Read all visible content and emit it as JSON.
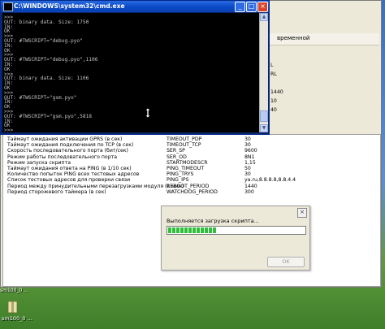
{
  "console": {
    "title": "C:\\WINDOWS\\system32\\cmd.exe",
    "lines": [
      ">>>",
      "OUT: binary data. Size: 1750",
      "IN:",
      "OK",
      ">>>",
      "OUT: #TWSCRIPT=\"debug.pyo\"",
      "IN:",
      "OK",
      ">>>",
      "OUT: #TWSCRIPT=\"debug.pyo\",1106",
      "IN:",
      "OK",
      ">>>",
      "OUT: binary data. Size: 1106",
      "IN:",
      "OK",
      ">>>",
      "OUT: #TWSCRIPT=\"gsm.pyo\"",
      "IN:",
      "OK",
      ">>>",
      "OUT: #TWSCRIPT=\"gsm.pyo\",5818",
      "IN:",
      "OK",
      ">>>"
    ]
  },
  "background_window": {
    "column_header": "временной",
    "side_values": [
      "L",
      "RL",
      "",
      "1440",
      "10",
      "40",
      "",
      "",
      ""
    ],
    "rows": [
      {
        "desc": "Таймаут ожидания активации GPRS (в сек)",
        "param": "TIMEOUT_PDP",
        "value": "30"
      },
      {
        "desc": "Таймаут ожидания подключения по TCP (в сек)",
        "param": "TIMEOUT_TCP",
        "value": "30"
      },
      {
        "desc": "Скорость последовательного порта (бит/сек)",
        "param": "SER_SP",
        "value": "9600"
      },
      {
        "desc": "Режим работы последовательного порта",
        "param": "SER_OD",
        "value": "8N1"
      },
      {
        "desc": "Режим запуска скрипта",
        "param": "STARTMODESCR",
        "value": "1,15"
      },
      {
        "desc": "Таймаут ожидания ответа на PING (в 1/10 сек)",
        "param": "PING_TIMEOUT",
        "value": "50"
      },
      {
        "desc": "Количество попыток PING всех тестовых адресов",
        "param": "PING_TRYS",
        "value": "30"
      },
      {
        "desc": "Список тестовых адресов для проверки связи",
        "param": "PING_IPS",
        "value": "ya.ru,8.8.8.8,8.8.4.4"
      },
      {
        "desc": "Период между принудительными перезагрузками модуля (в мин)",
        "param": "REBOOT_PERIOD",
        "value": "1440"
      },
      {
        "desc": "Период сторожевого таймера (в сек)",
        "param": "WATCHDOG_PERIOD",
        "value": "300"
      }
    ]
  },
  "dialog": {
    "message": "Выполняется загрузка скрипта...",
    "progress_segments": 12,
    "ok_label": "OK"
  },
  "desktop": {
    "caption": "sm100_0 ...",
    "icon_label": "sm100_0 ..."
  },
  "colors": {
    "titlebar": "#0b4bc8",
    "progress": "#2fbf3a",
    "console_text": "#c0c0c0"
  }
}
